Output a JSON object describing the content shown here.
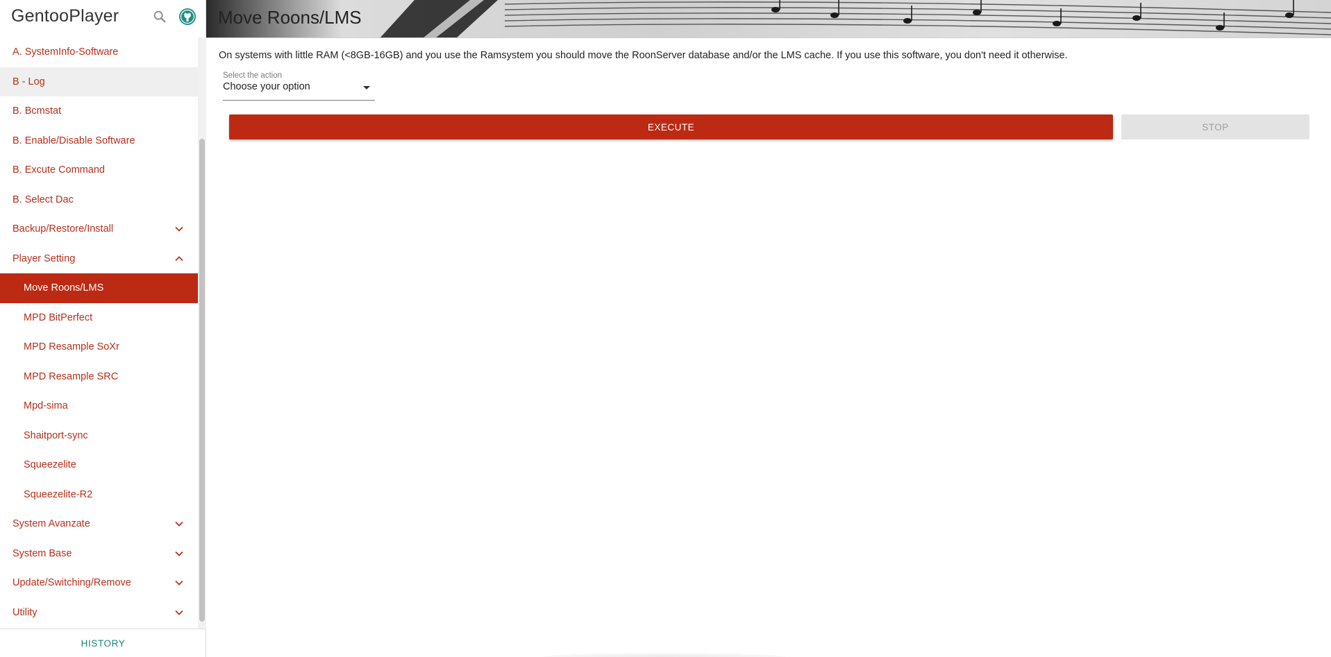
{
  "app": {
    "brand": "GentooPlayer",
    "accent_color": "#bd2a13",
    "teal_color": "#17857f"
  },
  "sidebar": {
    "items": [
      {
        "label": "A. SystemInfo-Software",
        "expandable": false
      },
      {
        "label": "B - Log",
        "expandable": false
      },
      {
        "label": "B. Bcmstat",
        "expandable": false
      },
      {
        "label": "B. Enable/Disable Software",
        "expandable": false
      },
      {
        "label": "B. Excute Command",
        "expandable": false
      },
      {
        "label": "B. Select Dac",
        "expandable": false
      },
      {
        "label": "Backup/Restore/Install",
        "expandable": true,
        "expanded": false
      },
      {
        "label": "Player Setting",
        "expandable": true,
        "expanded": true
      },
      {
        "label": "Move Roons/LMS",
        "sub": true,
        "selected": true
      },
      {
        "label": "MPD BitPerfect",
        "sub": true
      },
      {
        "label": "MPD Resample SoXr",
        "sub": true
      },
      {
        "label": "MPD Resample SRC",
        "sub": true
      },
      {
        "label": "Mpd-sima",
        "sub": true
      },
      {
        "label": "Shaitport-sync",
        "sub": true
      },
      {
        "label": "Squeezelite",
        "sub": true
      },
      {
        "label": "Squeezelite-R2",
        "sub": true
      },
      {
        "label": "System Avanzate",
        "expandable": true,
        "expanded": false
      },
      {
        "label": "System Base",
        "expandable": true,
        "expanded": false
      },
      {
        "label": "Update/Switching/Remove",
        "expandable": true,
        "expanded": false
      },
      {
        "label": "Utility",
        "expandable": true,
        "expanded": false
      }
    ],
    "footer_button": "HISTORY"
  },
  "header": {
    "title": "Move Roons/LMS"
  },
  "main": {
    "description": "On systems with little RAM (<8GB-16GB) and you use the Ramsystem you should move the RoonServer database and/or the LMS cache. If you use this software, you don't need it otherwise.",
    "select": {
      "label": "Select the action",
      "value": "Choose your option"
    },
    "execute_label": "EXECUTE",
    "stop_label": "STOP"
  },
  "icons": {
    "search": "search-icon",
    "github": "github-icon",
    "expand": "chevron-down-icon",
    "collapse": "chevron-up-icon"
  }
}
